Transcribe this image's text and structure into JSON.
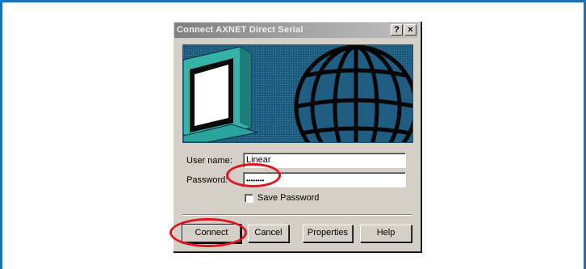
{
  "dialog": {
    "title": "Connect AXNET Direct Serial",
    "help_button": "?",
    "close_button": "×"
  },
  "form": {
    "username_label": "User name:",
    "username_value": "Linear",
    "password_label": "Password:",
    "password_value": "••••••••",
    "save_password_label": "Save Password",
    "save_password_checked": false
  },
  "buttons": {
    "connect": "Connect",
    "cancel": "Cancel",
    "properties": "Properties",
    "help": "Help"
  },
  "colors": {
    "frame_border": "#1a73b8",
    "highlight_ring": "#e0141e",
    "banner_background": "#1f5e82",
    "monitor_teal": "#2aa39c"
  },
  "icons": {
    "banner_monitor": "computer-monitor-icon",
    "banner_globe": "globe-icon"
  }
}
